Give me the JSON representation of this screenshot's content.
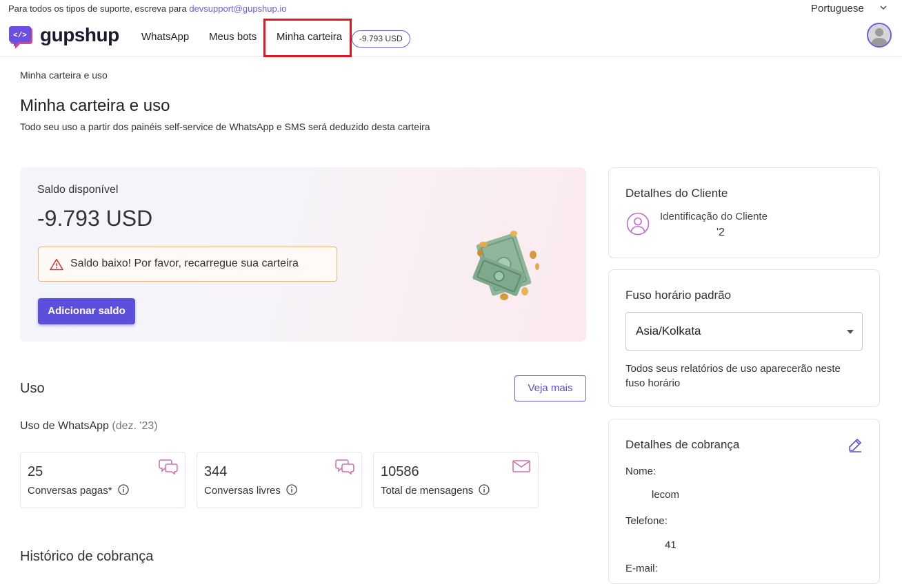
{
  "support": {
    "text": "Para todos os tipos de suporte, escreva para",
    "email": "devsupport@gupshup.io"
  },
  "language": {
    "selected": "Portuguese",
    "icon": "chevron-down-icon"
  },
  "brand": {
    "name": "gupshup",
    "accent": "#5b4fdc"
  },
  "nav": {
    "whatsapp": "WhatsApp",
    "bots": "Meus bots",
    "wallet": "Minha carteira",
    "balance_pill": "-9.793 USD"
  },
  "page": {
    "breadcrumb": "Minha carteira e uso",
    "title": "Minha carteira e uso",
    "subtitle": "Todo seu uso a partir dos painéis self-service de WhatsApp e SMS será deduzido desta carteira"
  },
  "balance": {
    "label": "Saldo disponível",
    "value": "-9.793 USD",
    "alert": "Saldo baixo! Por favor, recarregue sua carteira",
    "add_button": "Adicionar saldo"
  },
  "usage": {
    "title": "Uso",
    "see_more": "Veja mais",
    "wa_label": "Uso de WhatsApp",
    "wa_period": "(dez. '23)",
    "stats": [
      {
        "value": "25",
        "label": "Conversas pagas*",
        "icon": "chat-bubbles-icon"
      },
      {
        "value": "344",
        "label": "Conversas livres",
        "icon": "chat-bubbles-icon"
      },
      {
        "value": "10586",
        "label": "Total de mensagens",
        "icon": "mail-icon"
      }
    ]
  },
  "billing_history": {
    "title": "Histórico de cobrança"
  },
  "client": {
    "title": "Detalhes do Cliente",
    "id_label": "Identificação do Cliente",
    "id_value": "'2"
  },
  "timezone": {
    "title": "Fuso horário padrão",
    "selected": "Asia/Kolkata",
    "note": "Todos seus relatórios de uso aparecerão neste fuso horário"
  },
  "billing": {
    "title": "Detalhes de cobrança",
    "name_label": "Nome:",
    "name_value": "lecom",
    "phone_label": "Telefone:",
    "phone_value": "41",
    "email_label": "E-mail:"
  }
}
